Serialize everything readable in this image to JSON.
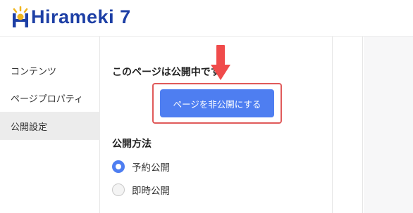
{
  "header": {
    "logo_text": "Hirameki 7"
  },
  "sidebar": {
    "items": [
      {
        "label": "コンテンツ"
      },
      {
        "label": "ページプロパティ"
      },
      {
        "label": "公開設定"
      }
    ]
  },
  "main": {
    "status_text": "このページは公開中です",
    "unpublish_button": "ページを非公開にする",
    "publish_method_title": "公開方法",
    "radio_options": [
      {
        "label": "予約公開",
        "selected": true
      },
      {
        "label": "即時公開",
        "selected": false
      }
    ]
  },
  "colors": {
    "accent": "#4e7ef1",
    "highlight": "#e05a5a",
    "logo": "#1d3fa5",
    "arrow": "#f04b4b"
  },
  "icons": {
    "logo_mark": "lightbulb-icon",
    "pointer": "down-arrow-icon"
  }
}
